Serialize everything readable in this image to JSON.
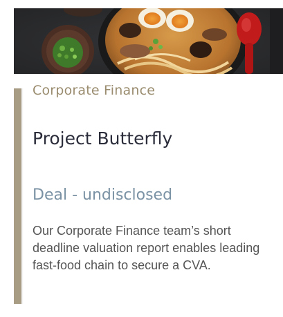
{
  "card": {
    "image_subject": "ramen-bowl-photo",
    "category": "Corporate Finance",
    "title": "Project Butterfly",
    "deal": "Deal - undisclosed",
    "description": "Our Corporate Finance team’s short deadline valuation report enables leading fast-food chain to secure a CVA."
  },
  "colors": {
    "accent_bar": "#a99c84",
    "category_text": "#9a8c6e",
    "title_text": "#2b2d3b",
    "deal_text": "#7a92a4",
    "body_text": "#555555",
    "spoon_red": "#c21b1b"
  },
  "icons": {
    "hero": "ramen-bowl-photo"
  }
}
